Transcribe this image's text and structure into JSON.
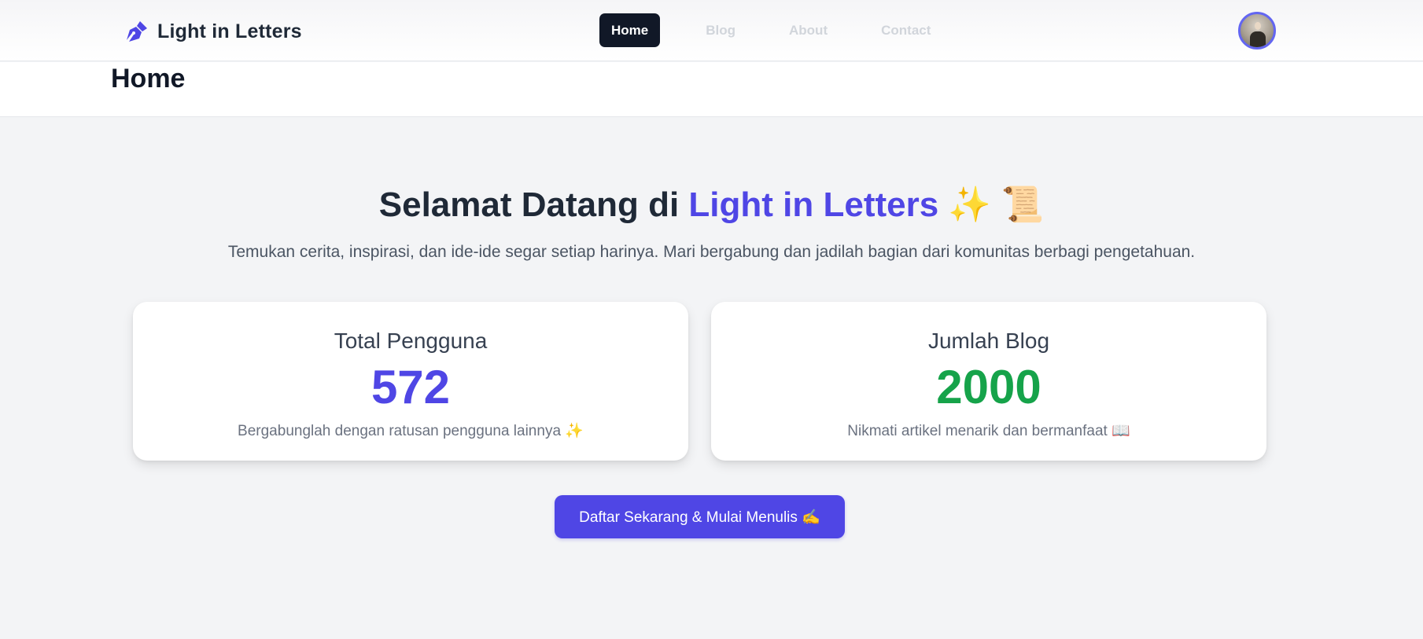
{
  "brand": {
    "name": "Light in Letters",
    "icon": "pen-nib-icon",
    "icon_color": "#4f46e5"
  },
  "nav": {
    "items": [
      {
        "label": "Home",
        "active": true
      },
      {
        "label": "Blog",
        "active": false
      },
      {
        "label": "About",
        "active": false
      },
      {
        "label": "Contact",
        "active": false
      }
    ]
  },
  "user": {
    "avatar": "user-avatar"
  },
  "page": {
    "title": "Home"
  },
  "hero": {
    "title_prefix": "Selamat Datang di ",
    "title_accent": "Light in Letters",
    "title_emoji": " ✨ 📜",
    "subtitle": "Temukan cerita, inspirasi, dan ide-ide segar setiap harinya. Mari bergabung dan jadilah bagian dari komunitas berbagi pengetahuan."
  },
  "stats": {
    "users": {
      "label": "Total Pengguna",
      "value": "572",
      "desc": "Bergabunglah dengan ratusan pengguna lainnya ✨",
      "color": "#4f46e5"
    },
    "blogs": {
      "label": "Jumlah Blog",
      "value": "2000",
      "desc": "Nikmati artikel menarik dan bermanfaat 📖",
      "color": "#16a34a"
    }
  },
  "cta": {
    "label": "Daftar Sekarang & Mulai Menulis ✍️",
    "color": "#4f46e5"
  },
  "colors": {
    "dark": "#111827",
    "background": "#f3f4f6",
    "accent": "#4f46e5",
    "success": "#16a34a"
  }
}
